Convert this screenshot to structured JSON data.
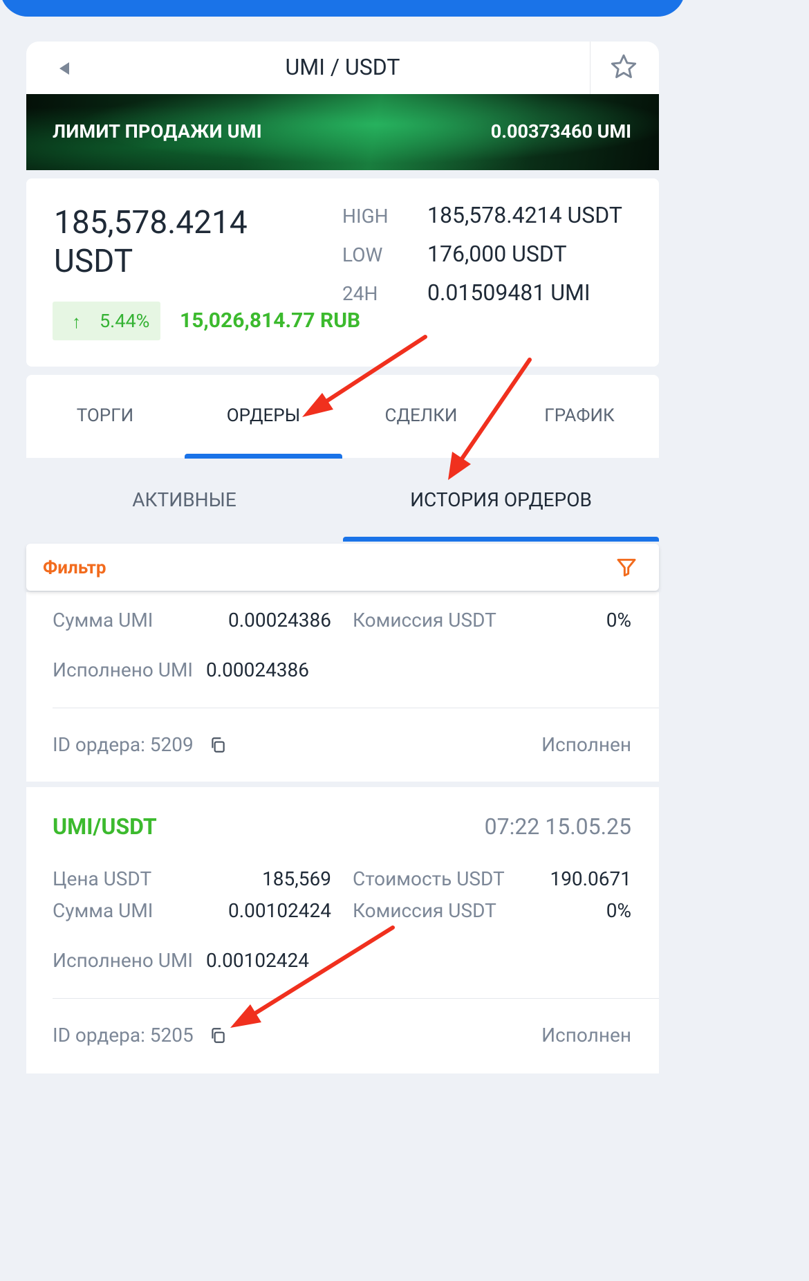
{
  "header": {
    "title": "UMI / USDT",
    "back_icon": "back-arrow-icon",
    "favorite_icon": "star-icon"
  },
  "banner": {
    "label": "ЛИМИТ ПРОДАЖИ UMI",
    "value": "0.00373460 UMI"
  },
  "price": {
    "main_line1": "185,578.4214",
    "main_line2": "USDT",
    "change_arrow": "↑",
    "change": "5.44%",
    "rub": "15,026,814.77 RUB",
    "stats": [
      {
        "label": "HIGH",
        "value": "185,578.4214 USDT"
      },
      {
        "label": "LOW",
        "value": "176,000 USDT"
      },
      {
        "label": "24H",
        "value": "0.01509481 UMI"
      }
    ]
  },
  "tabs": [
    "ТОРГИ",
    "ОРДЕРЫ",
    "СДЕЛКИ",
    "ГРАФИК"
  ],
  "active_tab": "ОРДЕРЫ",
  "subtabs": [
    "АКТИВНЫЕ",
    "ИСТОРИЯ ОРДЕРОВ"
  ],
  "active_subtab": "ИСТОРИЯ ОРДЕРОВ",
  "filter": {
    "label": "Фильтр",
    "icon": "filter-icon"
  },
  "orders": [
    {
      "amount_label": "Сумма UMI",
      "amount": "0.00024386",
      "fee_label": "Комиссия USDT",
      "fee": "0%",
      "filled_label": "Исполнено UMI",
      "filled": "0.00024386",
      "id_text": "ID ордера: 5209",
      "status": "Исполнен"
    },
    {
      "pair": "UMI/USDT",
      "time": "07:22 15.05.25",
      "price_label": "Цена USDT",
      "price": "185,569",
      "cost_label": "Стоимость USDT",
      "cost": "190.0671",
      "amount_label": "Сумма UMI",
      "amount": "0.00102424",
      "fee_label": "Комиссия USDT",
      "fee": "0%",
      "filled_label": "Исполнено UMI",
      "filled": "0.00102424",
      "id_text": "ID ордера: 5205",
      "status": "Исполнен"
    }
  ],
  "colors": {
    "accent": "#1a73e8",
    "positive": "#3cba2e",
    "filter": "#f26b1d",
    "annotation": "#f0301e"
  }
}
